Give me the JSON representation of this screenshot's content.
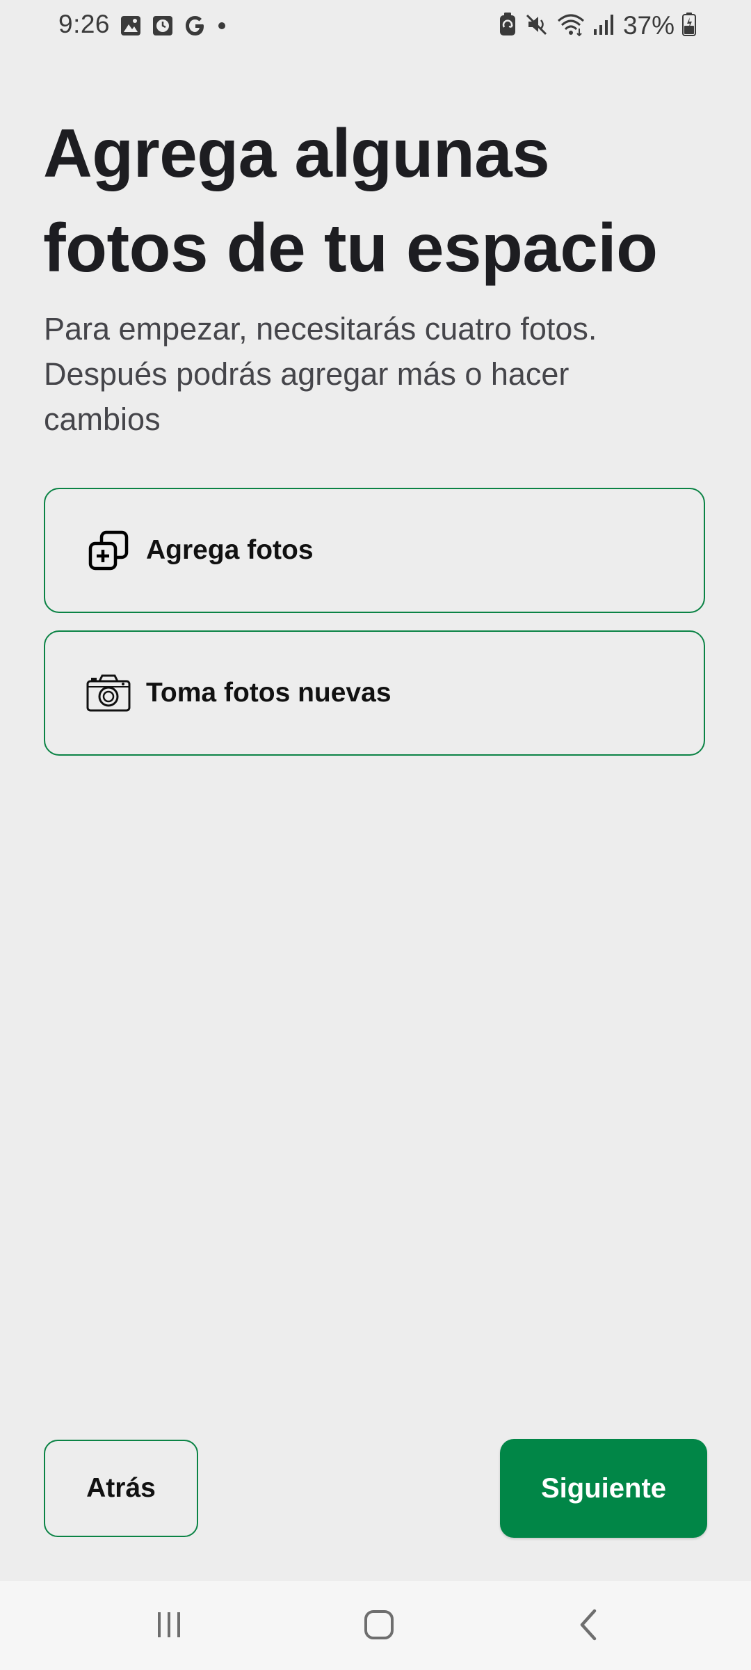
{
  "status_bar": {
    "time": "9:26",
    "left_icons": [
      "image-icon",
      "clock-app-icon",
      "google-icon",
      "dot-icon"
    ],
    "right_icons": [
      "battery-saver-icon",
      "mute-icon",
      "wifi-icon",
      "signal-icon"
    ],
    "battery": "37%"
  },
  "header": {
    "title_line1": "Agrega algunas",
    "title_line2": "fotos de tu espacio",
    "subtitle_line1": "Para empezar, necesitarás cuatro fotos.",
    "subtitle_line2": "Después podrás agregar más o hacer",
    "subtitle_line3": "cambios"
  },
  "options": [
    {
      "icon": "add-photos-icon",
      "label": "Agrega fotos"
    },
    {
      "icon": "camera-icon",
      "label": "Toma fotos nuevas"
    }
  ],
  "footer": {
    "back_label": "Atrás",
    "next_label": "Siguiente"
  },
  "nav_bar": {
    "buttons": [
      "recents-icon",
      "home-icon",
      "back-icon"
    ]
  },
  "colors": {
    "accent": "#018647",
    "border": "#0b8345",
    "background": "#ededed"
  }
}
